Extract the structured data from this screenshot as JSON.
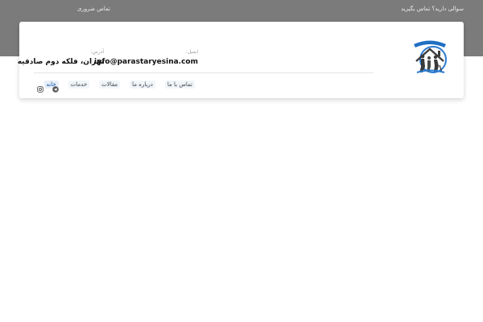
{
  "topbar": {
    "question_text": "سوالی دارید؟ تماس بگیرید",
    "emergency_text": "تماس ضروری"
  },
  "header": {
    "email_label": "ایمیل:",
    "email_value": "info@parastaryesina.com",
    "address_label": "آدرس:",
    "address_value": "تهران، فلکه دوم صادقیه",
    "logo_icon": "house-with-caregivers-logo"
  },
  "nav": {
    "items": [
      {
        "label": "خانه",
        "active": true
      },
      {
        "label": "خدمات",
        "active": false
      },
      {
        "label": "مقالات",
        "active": false
      },
      {
        "label": "درباره ما",
        "active": false
      },
      {
        "label": "تماس با ما",
        "active": false
      }
    ]
  },
  "social": {
    "telegram_icon": "telegram-icon",
    "instagram_icon": "instagram-icon"
  },
  "colors": {
    "topbar_bg": "#7b7b7b",
    "accent": "#1a5fb4"
  }
}
